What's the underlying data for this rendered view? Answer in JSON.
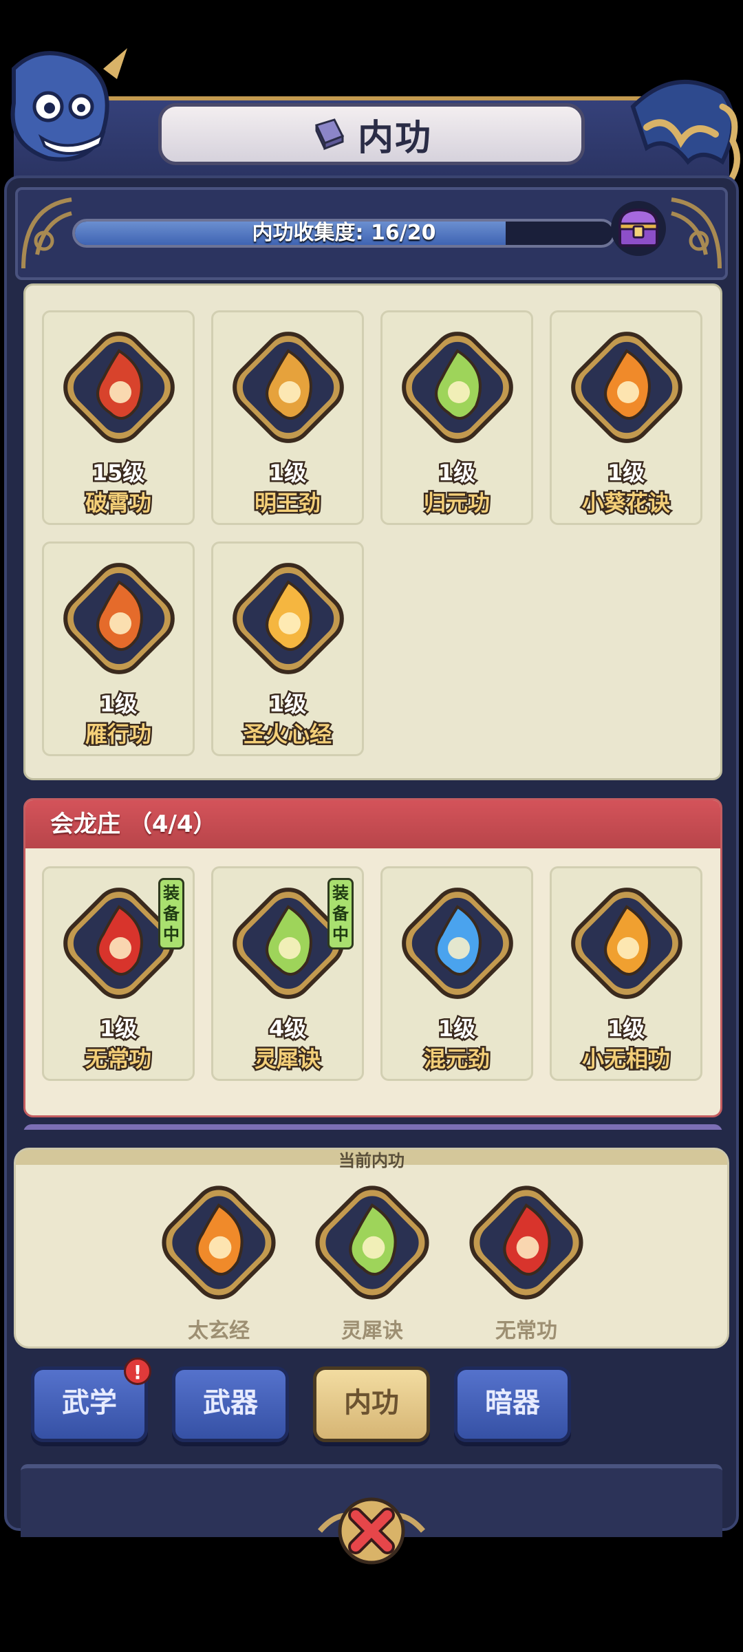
{
  "title": "内功",
  "collection": {
    "label": "内功收集度: 16/20",
    "current": 16,
    "total": 20
  },
  "owned": [
    {
      "level": "15级",
      "name": "破霄功",
      "color": "#d8432c"
    },
    {
      "level": "1级",
      "name": "明王劲",
      "color": "#e6a23c"
    },
    {
      "level": "1级",
      "name": "归元功",
      "color": "#9ed45a"
    },
    {
      "level": "1级",
      "name": "小葵花诀",
      "color": "#f08a2a"
    },
    {
      "level": "1级",
      "name": "雁行功",
      "color": "#e56b2b"
    },
    {
      "level": "1级",
      "name": "圣火心经",
      "color": "#f5b640"
    }
  ],
  "set_section": {
    "title": "会龙庄 （4/4）",
    "items": [
      {
        "level": "1级",
        "name": "无常功",
        "equipped": true,
        "equip_tag": "装备中",
        "color": "#d8342c"
      },
      {
        "level": "4级",
        "name": "灵犀诀",
        "equipped": true,
        "equip_tag": "装备中",
        "color": "#9ed45a"
      },
      {
        "level": "1级",
        "name": "混元劲",
        "equipped": false,
        "equip_tag": "",
        "color": "#4aa3ee"
      },
      {
        "level": "1级",
        "name": "小无相功",
        "equipped": false,
        "equip_tag": "",
        "color": "#f0a030"
      }
    ]
  },
  "current_section": {
    "label": "当前内功",
    "items": [
      {
        "name": "太玄经",
        "color": "#f08a2a"
      },
      {
        "name": "灵犀诀",
        "color": "#9ed45a"
      },
      {
        "name": "无常功",
        "color": "#d8342c"
      }
    ]
  },
  "tabs": [
    {
      "label": "武学",
      "active": false,
      "badge": "!"
    },
    {
      "label": "武器",
      "active": false,
      "badge": ""
    },
    {
      "label": "内功",
      "active": true,
      "badge": ""
    },
    {
      "label": "暗器",
      "active": false,
      "badge": ""
    }
  ],
  "icons": {
    "close": "close-x-icon",
    "chest": "treasure-chest-icon",
    "book": "book-icon"
  }
}
